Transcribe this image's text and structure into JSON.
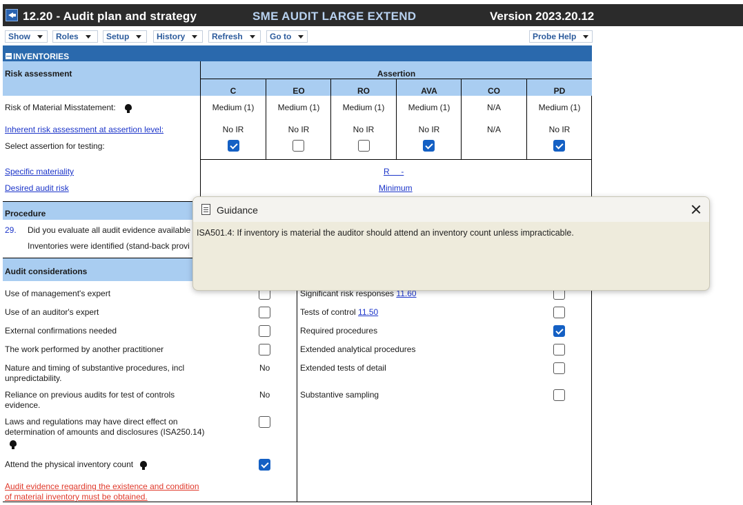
{
  "window": {
    "title": "12.20 - Audit plan and strategy",
    "product": "SME AUDIT LARGE EXTEND",
    "version": "Version 2023.20.12"
  },
  "menu": {
    "items": [
      "Show",
      "Roles",
      "Setup",
      "History",
      "Refresh",
      "Go to"
    ],
    "help": "Probe Help"
  },
  "section": {
    "title": "INVENTORIES"
  },
  "risk": {
    "heading": "Risk assessment",
    "assertion_heading": "Assertion",
    "columns": [
      "C",
      "EO",
      "RO",
      "AVA",
      "CO",
      "PD"
    ],
    "rmm_label": "Risk of Material Misstatement:",
    "rmm_values": [
      "Medium (1)",
      "Medium (1)",
      "Medium (1)",
      "Medium (1)",
      "N/A",
      "Medium (1)"
    ],
    "inherent_label": "Inherent risk assessment at assertion level:",
    "inherent_values": [
      "No IR",
      "No IR",
      "No IR",
      "No IR",
      "N/A",
      "No IR"
    ],
    "select_label": "Select assertion for testing:",
    "select_checked": [
      true,
      false,
      false,
      true,
      null,
      true
    ],
    "materiality_label": "Specific materiality",
    "materiality_value": "R     -",
    "audit_risk_label": "Desired audit risk",
    "audit_risk_value": "Minimum"
  },
  "procedure": {
    "heading": "Procedure",
    "number": "29.",
    "question": "Did you evaluate all audit evidence available",
    "subtext": "Inventories were identified (stand-back provi"
  },
  "considerations": {
    "heading": "Audit considerations",
    "left": [
      {
        "label": "Use of management's expert",
        "checked": false
      },
      {
        "label": "Use of an auditor's expert",
        "checked": false
      },
      {
        "label": "External confirmations needed",
        "checked": false
      },
      {
        "label": "The work performed by another practitioner",
        "checked": false
      },
      {
        "label": "Nature and timing of substantive procedures, incl unpredictability.",
        "value": "No"
      },
      {
        "label": "Reliance on previous audits for test of controls evidence.",
        "value": "No"
      },
      {
        "label": "Laws and regulations may have direct effect on determination of amounts and disclosures (ISA250.14)",
        "checked": false
      },
      {
        "label": "Attend the physical inventory count",
        "checked": true
      }
    ],
    "right": [
      {
        "label": "Significant risk responses",
        "link": "11.60",
        "checked": false
      },
      {
        "label": "Tests of control",
        "link": "11.50",
        "checked": false
      },
      {
        "label": "Required procedures",
        "checked": true
      },
      {
        "label": "Extended analytical procedures",
        "checked": false
      },
      {
        "label": "Extended tests of detail",
        "checked": false
      },
      {
        "label": "Substantive sampling",
        "checked": false
      }
    ],
    "warning_line1": "Audit evidence regarding the existence and condition",
    "warning_line2": "of material inventory must be obtained."
  },
  "guidance": {
    "title": "Guidance",
    "text": "ISA501.4: If inventory is material the auditor should attend an inventory count unless impracticable."
  },
  "colors": {
    "title_bar": "#2b2b2b",
    "section_header": "#2a69ad",
    "light_band": "#a9cdf1",
    "checkbox_on": "#1460c4",
    "link": "#1b34c9",
    "warning": "#e0392b",
    "popup_bg": "#eeebdc"
  }
}
